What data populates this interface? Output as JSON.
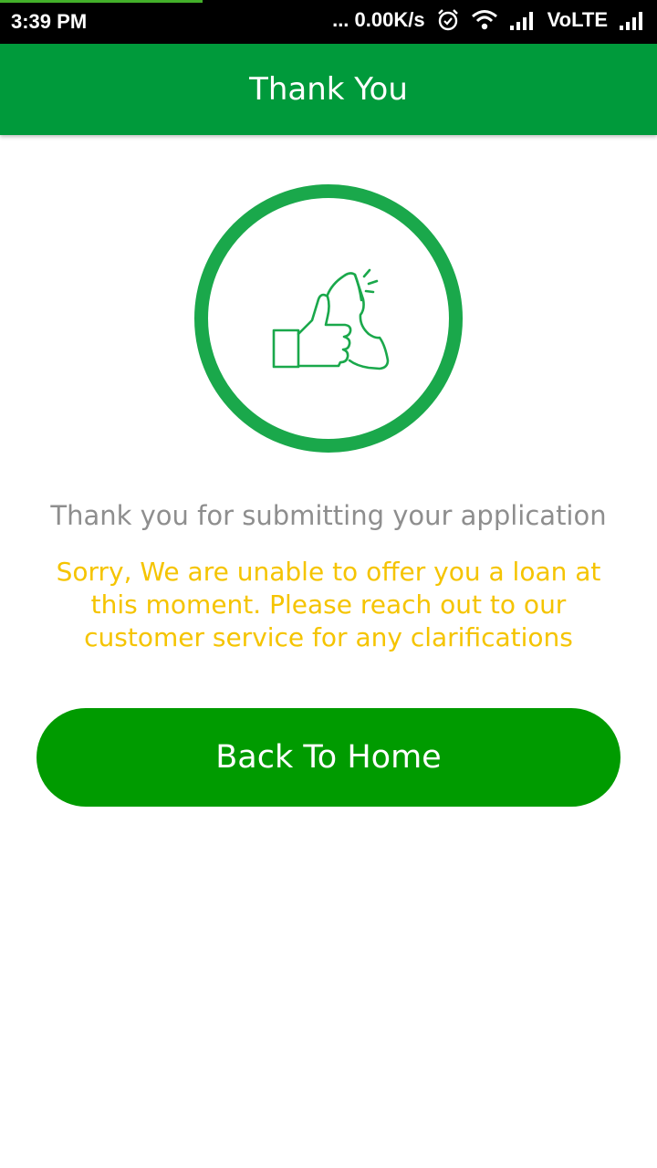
{
  "status_bar": {
    "time": "3:39 PM",
    "network_speed": "... 0.00K/s",
    "carrier_label": "VoLTE",
    "icons": [
      "alarm-icon",
      "wifi-icon",
      "signal-icon",
      "signal-icon"
    ]
  },
  "header": {
    "title": "Thank You"
  },
  "hero": {
    "icon": "thumbs-up-megaphone-icon"
  },
  "main": {
    "thanks_message": "Thank you for submitting your application",
    "sorry_message": "Sorry, We are unable to offer you a loan at this moment. Please reach out to our customer service for any clarifications"
  },
  "actions": {
    "home_button_label": "Back To Home"
  },
  "colors": {
    "app_bar": "#009a3b",
    "circle": "#1aa84b",
    "button": "#009b00",
    "sorry_text": "#f5c400",
    "thanks_text": "#8e8e8e"
  }
}
